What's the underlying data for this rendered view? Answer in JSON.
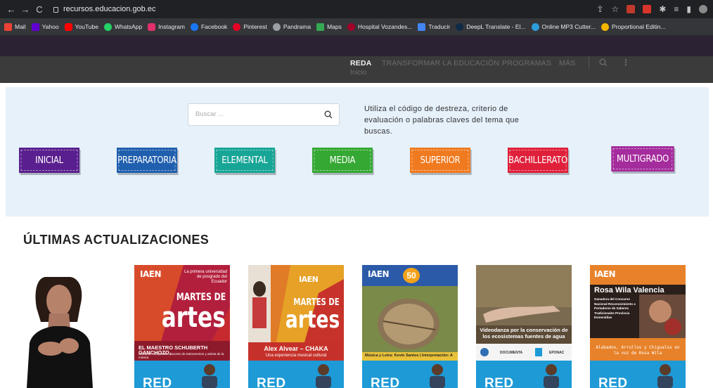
{
  "browser": {
    "url": "recursos.educacion.gob.ec",
    "bookmarks": [
      "Mail",
      "Yahoo",
      "YouTube",
      "WhatsApp",
      "Instagram",
      "Facebook",
      "Pinterest",
      "Pandrama",
      "Maps",
      "Hospital Vozandes...",
      "Traducir",
      "DeepL Translate - El...",
      "Online MP3 Cutter...",
      "Proportional Editin..."
    ]
  },
  "nav": {
    "items": [
      "REDA",
      "TRANSFORMAR LA EDUCACIÓN",
      "PROGRAMAS",
      "MÁS"
    ],
    "sub": "Inicio"
  },
  "search": {
    "placeholder": "Buscar ...",
    "hint": "Utiliza el código de destreza, criterio de evaluación o palabras claves del tema que buscas."
  },
  "levels": [
    {
      "label": "INICIAL",
      "color": "#5a1f8e"
    },
    {
      "label": "PREPARATORIA",
      "color": "#1f5fae"
    },
    {
      "label": "ELEMENTAL",
      "color": "#17a596"
    },
    {
      "label": "MEDIA",
      "color": "#35a833"
    },
    {
      "label": "SUPERIOR",
      "color": "#f07a1f"
    },
    {
      "label": "BACHILLERATO",
      "color": "#e0203a"
    },
    {
      "label": "MULTIGRADO",
      "color": "#a42c9c"
    }
  ],
  "updates": {
    "title": "ÚLTIMAS ACTUALIZACIONES",
    "footer_label": "RED",
    "cards": [
      {
        "brand": "IAEN",
        "tagline": "La primera universidad de posgrado del Ecuador",
        "series_1": "MARTES DE",
        "series_2": "artes",
        "caption": "EL MAESTRO SCHUBERTH GANCHOZO,",
        "subcaption": "cantante, compositor, docente de instrumentos y artista de la música"
      },
      {
        "brand": "IAEN",
        "series_1": "MARTES DE",
        "series_2": "artes",
        "caption": "Alex Alvear – CHAKA",
        "subcaption": "Una experiencia musical cultural"
      },
      {
        "brand": "IAEN",
        "badge": "50",
        "caption": "Música y Letra: Kevin Santos  |  Interpretación: A"
      },
      {
        "caption": "Videodanza por la conservación de los ecosistemas fuentes de agua",
        "logos": [
          "DOCUMENTA",
          "EPONAC"
        ]
      },
      {
        "brand": "IAEN",
        "person": "Rosa Wila Valencia",
        "award": "Ganadora del Concurso Nacional Reconocimiento a Portadores de Saberes Tradicionales Provincia Esmeraldas",
        "caption": "Alabados, Arrullos y Chigualos en la voz de Rosa Wila"
      }
    ]
  }
}
